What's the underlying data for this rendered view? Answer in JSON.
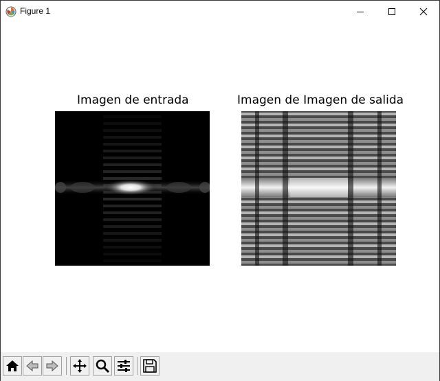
{
  "window": {
    "title": "Figure 1",
    "icon": "matplotlib-icon",
    "controls": [
      "minimize-icon",
      "maximize-icon",
      "close-icon"
    ]
  },
  "figure": {
    "axes": [
      {
        "title": "Imagen de entrada",
        "image": "grayscale image: single bright horizontal band at center with faint periodic vertical stripes on black"
      },
      {
        "title": "Imagen de Imagen de salida",
        "image": "grayscale image: bright central horizontal band with many repeated horizontal stripes and dark vertical columns"
      }
    ]
  },
  "toolbar": {
    "buttons": [
      "home-icon",
      "back-arrow-icon",
      "forward-arrow-icon",
      "pan-icon",
      "zoom-icon",
      "configure-subplots-icon",
      "save-icon"
    ]
  },
  "colors": {
    "toolbar_bg": "#f0f0f0",
    "canvas_bg": "#ffffff"
  }
}
